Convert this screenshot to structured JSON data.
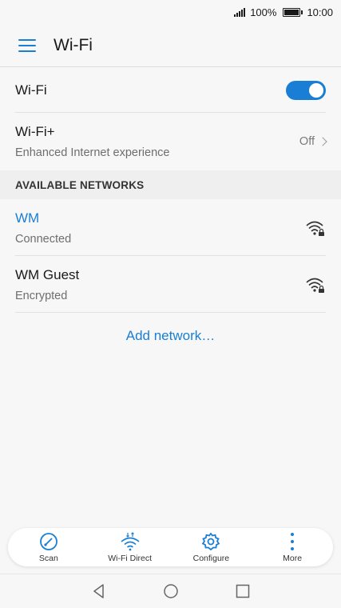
{
  "status_bar": {
    "battery": "100%",
    "time": "10:00"
  },
  "app_bar": {
    "title": "Wi-Fi"
  },
  "wifi_toggle": {
    "label": "Wi-Fi",
    "state": "on"
  },
  "wifi_plus": {
    "label": "Wi-Fi+",
    "description": "Enhanced Internet experience",
    "value": "Off"
  },
  "section": {
    "header": "AVAILABLE NETWORKS"
  },
  "networks": [
    {
      "name": "WM",
      "status": "Connected"
    },
    {
      "name": "WM Guest",
      "status": "Encrypted"
    }
  ],
  "add_network": {
    "label": "Add network…"
  },
  "toolbar": {
    "scan": "Scan",
    "wifi_direct": "Wi-Fi Direct",
    "configure": "Configure",
    "more": "More"
  },
  "colors": {
    "accent": "#1a7fd4"
  }
}
